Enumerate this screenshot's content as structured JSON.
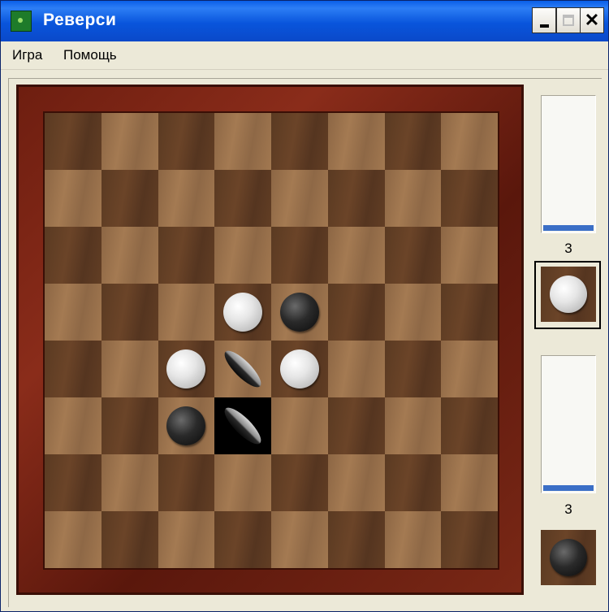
{
  "window": {
    "title": "Реверси",
    "icon": "reversi-app-icon"
  },
  "menu": {
    "items": [
      "Игра",
      "Помощь"
    ]
  },
  "board": {
    "size": 8,
    "rows": [
      [
        "",
        "",
        "",
        "",
        "",
        "",
        "",
        ""
      ],
      [
        "",
        "",
        "",
        "",
        "",
        "",
        "",
        ""
      ],
      [
        "",
        "",
        "",
        "",
        "",
        "",
        "",
        ""
      ],
      [
        "",
        "",
        "",
        "W",
        "B",
        "",
        "",
        ""
      ],
      [
        "",
        "",
        "W",
        "F",
        "W",
        "",
        "",
        ""
      ],
      [
        "",
        "",
        "B",
        "F*",
        "",
        "",
        "",
        ""
      ],
      [
        "",
        "",
        "",
        "",
        "",
        "",
        "",
        ""
      ],
      [
        "",
        "",
        "",
        "",
        "",
        "",
        "",
        ""
      ]
    ],
    "legend": {
      "W": "white disc",
      "B": "black disc",
      "F": "flipping disc",
      "*": "last-move highlight"
    }
  },
  "players": [
    {
      "color": "white",
      "count": "3",
      "active": true,
      "gauge_fraction": 0.04
    },
    {
      "color": "black",
      "count": "3",
      "active": false,
      "gauge_fraction": 0.04
    }
  ],
  "colors": {
    "title_bar": "#0A55DC",
    "gauge_fill": "#3B6FC6",
    "frame": "#7A2816"
  }
}
